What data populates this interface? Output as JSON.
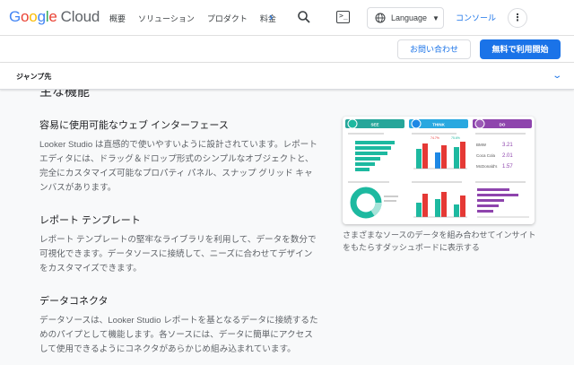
{
  "nav": {
    "logo": {
      "g1": "G",
      "g2": "o",
      "g3": "o",
      "g4": "g",
      "g5": "l",
      "g6": "e",
      "cloud": "Cloud"
    },
    "links": [
      "概要",
      "ソリューション",
      "プロダクト",
      "料金"
    ],
    "more_glyph": "›",
    "search_icon": "search-icon",
    "cloud_shell_glyph": ">_",
    "language_label": "Language",
    "console_label": "コンソール",
    "kebab_glyph": "⋮"
  },
  "actions": {
    "contact_label": "お問い合わせ",
    "start_label": "無料で利用開始"
  },
  "jump": {
    "label": "ジャンプ先",
    "chevron": "⌄"
  },
  "content": {
    "section_heading": "主な機能",
    "blocks": [
      {
        "title": "容易に使用可能なウェブ インターフェース",
        "text": "Looker Studio は直感的で使いやすいように設計されています。レポート エディタには、ドラッグ＆ドロップ形式のシンプルなオブジェクトと、完全にカスタマイズ可能なプロパティ パネル、スナップ グリッド キャンバスがあります。"
      },
      {
        "title": "レポート テンプレート",
        "text": "レポート テンプレートの堅牢なライブラリを利用して、データを数分で可視化できます。データソースに接続して、ニーズに合わせてデザインをカスタマイズできます。"
      },
      {
        "title": "データコネクタ",
        "text": "データソースは、Looker Studio レポートを基となるデータに接続するためのパイプとして機能します。各ソースには、データに簡単にアクセスして使用できるようにコネクタがあらかじめ組み込まれています。"
      }
    ],
    "image_caption": "さまざまなソースのデータを組み合わせてインサイトをもたらすダッシュボードに表示する",
    "dashboard": {
      "col1_title": "SEE",
      "col2_title": "THINK",
      "col3_title": "DO",
      "do_rows": [
        {
          "label": "BMW",
          "value": "3.21"
        },
        {
          "label": "Coca Cola",
          "value": "2.01"
        },
        {
          "label": "McDonald's",
          "value": "1.57"
        }
      ],
      "think_pcts": [
        "74.7%",
        "75.6%"
      ],
      "colors": {
        "see": "#26a69a",
        "think": "#29a8e0",
        "do": "#8e44ad",
        "bar_green": "#1db9a0",
        "bar_red": "#e53935",
        "bar_blue": "#1e88e5",
        "bar_purple": "#8e44ad"
      }
    }
  }
}
